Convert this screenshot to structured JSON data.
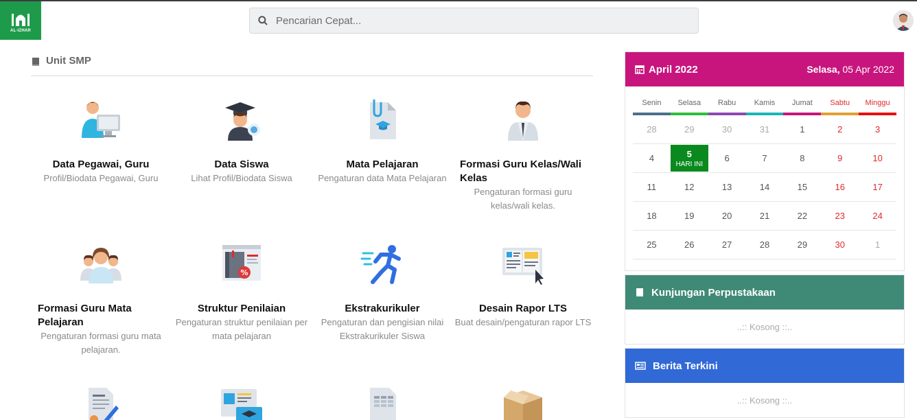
{
  "search": {
    "placeholder": "Pencarian Cepat..."
  },
  "logo": {
    "text": "AL-IZHAR"
  },
  "section": {
    "title": "Unit SMP"
  },
  "tiles": [
    {
      "title": "Data Pegawai, Guru",
      "desc": "Profil/Biodata Pegawai, Guru",
      "icon": "employee-computer-icon"
    },
    {
      "title": "Data Siswa",
      "desc": "Lihat Profil/Biodata Siswa",
      "icon": "graduate-student-icon"
    },
    {
      "title": "Mata Pelajaran",
      "desc": "Pengaturan data Mata Pelajaran",
      "icon": "subject-document-icon"
    },
    {
      "title": "Formasi Guru Kelas/Wali Kelas",
      "desc": "Pengaturan formasi guru kelas/wali kelas.",
      "icon": "teacher-icon"
    },
    {
      "title": "Formasi Guru Mata Pelajaran",
      "desc": "Pengaturan formasi guru mata pelajaran.",
      "icon": "teacher-group-icon"
    },
    {
      "title": "Struktur Penilaian",
      "desc": "Pengaturan struktur penilaian per mata pelajaran",
      "icon": "grading-book-icon"
    },
    {
      "title": "Ekstrakurikuler",
      "desc": "Pengaturan dan pengisian nilai Ekstrakurikuler Siswa",
      "icon": "running-person-icon"
    },
    {
      "title": "Desain Rapor LTS",
      "desc": "Buat desain/pengaturan rapor LTS",
      "icon": "report-design-icon"
    }
  ],
  "calendar": {
    "month": "April 2022",
    "day_name": "Selasa,",
    "date": "05 Apr 2022",
    "weekdays": [
      "Senin",
      "Selasa",
      "Rabu",
      "Kamis",
      "Jumat",
      "Sabtu",
      "Minggu"
    ],
    "weekday_colors": [
      "#4a6f8a",
      "#2ebd3c",
      "#8f47b3",
      "#1bb5b5",
      "#c8157e",
      "#e0a030",
      "#e81010"
    ],
    "today_label": "HARI INI",
    "weeks": [
      [
        "28",
        "29",
        "30",
        "31",
        "1",
        "2",
        "3"
      ],
      [
        "4",
        "5",
        "6",
        "7",
        "8",
        "9",
        "10"
      ],
      [
        "11",
        "12",
        "13",
        "14",
        "15",
        "16",
        "17"
      ],
      [
        "18",
        "19",
        "20",
        "21",
        "22",
        "23",
        "24"
      ],
      [
        "25",
        "26",
        "27",
        "28",
        "29",
        "30",
        "1"
      ]
    ]
  },
  "library": {
    "title": "Kunjungan Perpustakaan",
    "empty": "..:: Kosong ::..",
    "color": "#3f8a76"
  },
  "news": {
    "title": "Berita Terkini",
    "empty": "..:: Kosong ::..",
    "color": "#3169d6"
  },
  "colors": {
    "brand": "#1e9b4a",
    "calendar_header": "#c8157e",
    "today": "#0a8a1e"
  }
}
